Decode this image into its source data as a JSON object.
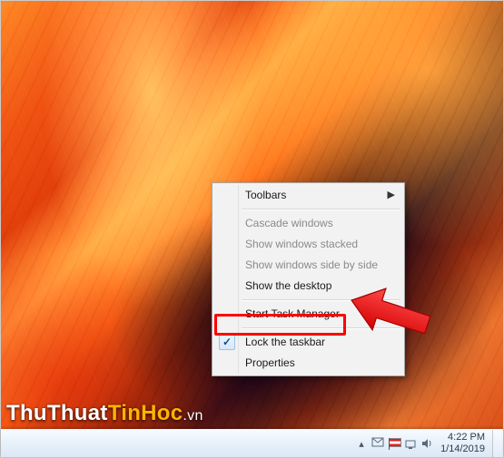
{
  "watermark": {
    "part1": "ThuThuat",
    "part2": "TinHoc",
    "part3": ".vn"
  },
  "context_menu": {
    "toolbars": "Toolbars",
    "cascade": "Cascade windows",
    "stacked": "Show windows stacked",
    "side_by_side": "Show windows side by side",
    "show_desktop": "Show the desktop",
    "task_manager": "Start Task Manager",
    "lock_taskbar": "Lock the taskbar",
    "properties": "Properties"
  },
  "clock": {
    "time": "4:22 PM",
    "date": "1/14/2019"
  },
  "highlight_target": "task_manager"
}
